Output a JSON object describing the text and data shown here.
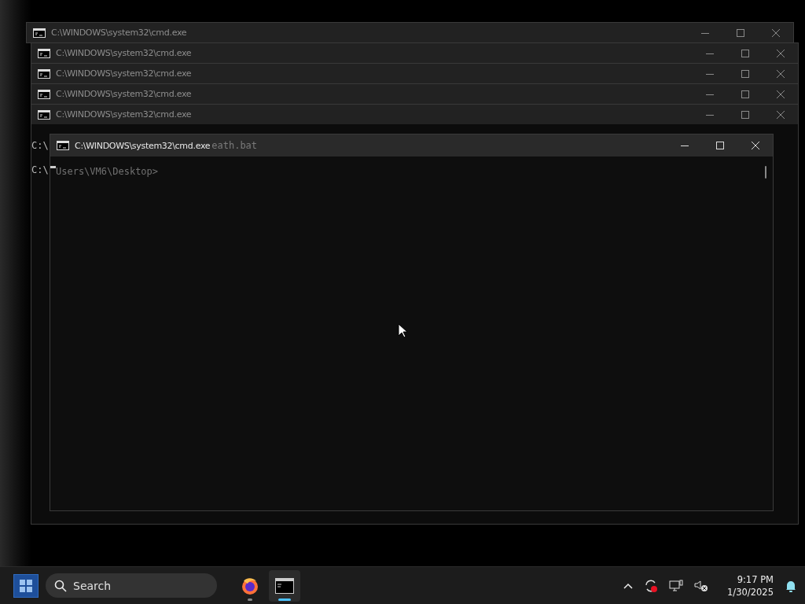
{
  "desktop": {
    "windows": [
      {
        "title": "C:\\WINDOWS\\system32\\cmd.exe"
      },
      {
        "title": "C:\\WINDOWS\\system32\\cmd.exe"
      },
      {
        "title": "C:\\WINDOWS\\system32\\cmd.exe"
      },
      {
        "title": "C:\\WINDOWS\\system32\\cmd.exe"
      },
      {
        "title": "C:\\WINDOWS\\system32\\cmd.exe"
      }
    ],
    "console_lines": [
      "C:\\",
      "C:\\"
    ]
  },
  "front_window": {
    "title": "C:\\WINDOWS\\system32\\cmd.exe",
    "ghost_title_text": "eath.bat",
    "console_text": "Users\\VM6\\Desktop>"
  },
  "taskbar": {
    "search": {
      "placeholder": "Search"
    },
    "apps": [
      {
        "kind": "browser",
        "selected": false
      },
      {
        "kind": "terminal",
        "selected": true
      }
    ],
    "tray": {
      "time": "9:17 PM",
      "date": "1/30/2025"
    }
  }
}
